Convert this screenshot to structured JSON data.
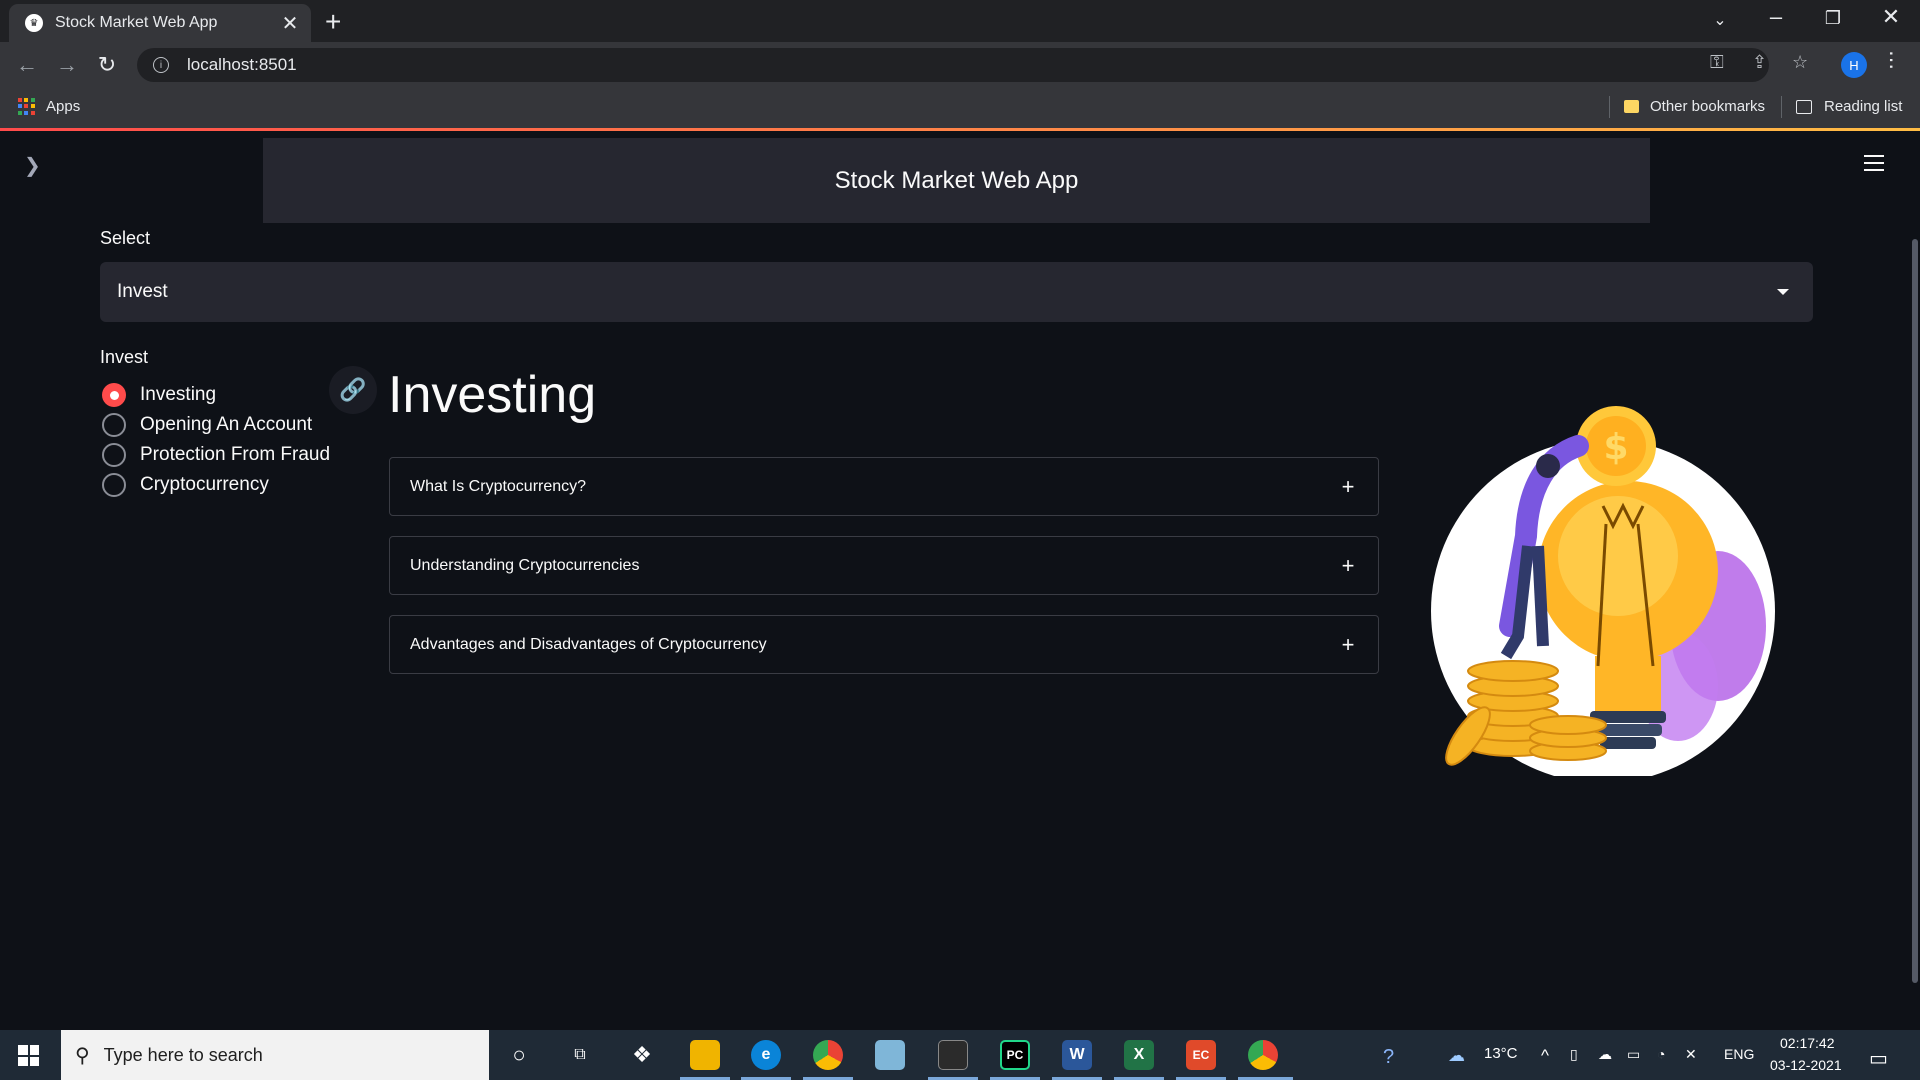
{
  "browser": {
    "tab_title": "Stock Market Web App",
    "url": "localhost:8501",
    "profile_initial": "H",
    "bookmarks": {
      "apps": "Apps",
      "other_bookmarks": "Other bookmarks",
      "reading_list": "Reading list"
    }
  },
  "app": {
    "header_title": "Stock Market Web App",
    "select_label": "Select",
    "select_value": "Invest",
    "radio_group_label": "Invest",
    "radio_options": [
      {
        "label": "Investing",
        "checked": true
      },
      {
        "label": "Opening An Account",
        "checked": false
      },
      {
        "label": "Protection From Fraud",
        "checked": false
      },
      {
        "label": "Cryptocurrency",
        "checked": false
      }
    ],
    "page_heading": "Investing",
    "expanders": [
      {
        "title": "What Is Cryptocurrency?"
      },
      {
        "title": "Understanding Cryptocurrencies"
      },
      {
        "title": "Advantages and Disadvantages of Cryptocurrency"
      }
    ],
    "illustration": "investment-lightbulb-coins-illustration"
  },
  "taskbar": {
    "search_placeholder": "Type here to search",
    "weather": "13°C",
    "language": "ENG",
    "time": "02:17:42",
    "date": "03-12-2021",
    "pinned_icons": [
      "cortana-icon",
      "task-view-icon",
      "dropbox-icon",
      "file-explorer-icon",
      "edge-icon",
      "chrome-icon",
      "notes-icon",
      "terminal-icon",
      "pycharm-icon",
      "word-icon",
      "excel-icon",
      "app-icon",
      "chrome-profile-icon"
    ]
  },
  "colors": {
    "accent": "#ff4b4b",
    "app_bg": "#0e1117",
    "panel": "#262730"
  }
}
